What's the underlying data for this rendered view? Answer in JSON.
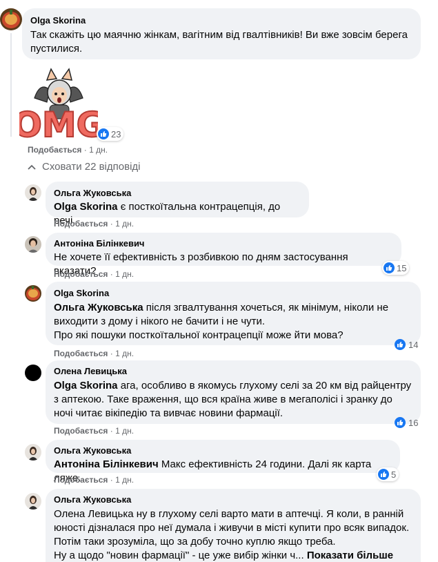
{
  "top_comment": {
    "author": "Olga Skorina",
    "text_line1": "Так скажіть цю маячню жінкам, вагітним від гвалтівників! Ви вже зовсім берега",
    "text_line2": "пустилися.",
    "sticker_text": "OMG",
    "reaction_count": "23",
    "like_label": "Подобається",
    "time": "1 дн."
  },
  "hide_replies": "Сховати 22 відповіді",
  "replies": [
    {
      "author": "Ольга Жуковська",
      "mention": "Olga Skorina",
      "text": " є посткоїтальна контрацепція, до речі.",
      "like_label": "Подобається",
      "time": "1 дн."
    },
    {
      "author": "Антоніна Білінкевич",
      "text": "Не хочете її ефективність з розбивкою по дням застосування вказати?",
      "reaction_count": "15",
      "like_label": "Подобається",
      "time": "1 дн."
    },
    {
      "author": "Olga Skorina",
      "mention": "Ольга Жуковська",
      "line1": " після згвалтування хочеться, як мінімум, ніколи не",
      "line2": "виходити з дому і нікого не бачити і не чути.",
      "line3": "Про які пошуки посткоїтальної контрацепції може йти мова?",
      "reaction_count": "14",
      "like_label": "Подобається",
      "time": "1 дн."
    },
    {
      "author": "Олена Левицька",
      "mention": "Olga Skorina",
      "line1": " ага, особливо в якомусь глухому селі за 20 км від райцентру",
      "line2": "з аптекою. Таке враження, що вся країна живе в мегаполісі і зранку до",
      "line3": "ночі читає вікіпедію та вивчає новини фармації.",
      "reaction_count": "16",
      "like_label": "Подобається",
      "time": "1 дн."
    },
    {
      "author": "Ольга Жуковська",
      "mention": "Антоніна Білінкевич",
      "text": " Макс ефективність 24 години. Далі як карта ляже.",
      "reaction_count": "5",
      "like_label": "Подобається",
      "time": "1 дн."
    },
    {
      "author": "Ольга Жуковська",
      "line1": "Олена Левицька ну в глухому селі варто мати в аптечці. Я коли, в ранній",
      "line2": "юності дізналася про неї думала і живучи в місті купити про всяк випадок.",
      "line3": "Потім таки зрозуміла, що за добу точно куплю якщо треба.",
      "line4": "Ну а щодо \"новин фармації\" - це уже вибір жінки ч...",
      "see_more": "Показати більше"
    }
  ],
  "colors": {
    "bubble": "#f0f2f5",
    "meta": "#65676b",
    "like_blue": "#1877f2"
  }
}
